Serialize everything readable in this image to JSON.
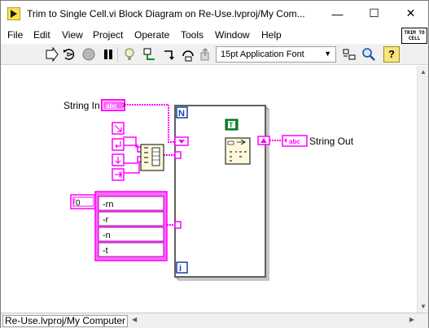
{
  "window": {
    "title": "Trim to Single Cell.vi Block Diagram on Re-Use.lvproj/My Com...",
    "minimize_glyph": "—",
    "maximize_glyph": "☐",
    "close_glyph": "✕"
  },
  "menu": {
    "items": [
      "File",
      "Edit",
      "View",
      "Project",
      "Operate",
      "Tools",
      "Window",
      "Help"
    ]
  },
  "vi_icon": {
    "line1": "TRIM TO",
    "line2": "CELL"
  },
  "toolbar": {
    "icons": [
      "run-arrow-icon",
      "run-continuously-icon",
      "abort-icon",
      "pause-icon",
      "highlight-execution-icon",
      "retain-wire-values-icon",
      "step-into-icon",
      "step-over-icon",
      "step-out-icon"
    ],
    "font_select": "15pt Application Font",
    "help_label": "?"
  },
  "diagram": {
    "string_in_label": "String In",
    "string_out_label": "String Out",
    "terminal_type": "abc",
    "loop_count_label": "N",
    "loop_iteration_label": "i",
    "case_true_label": "T",
    "array_index": "0",
    "array_items": [
      "-rn",
      "-r",
      "-n",
      "-t"
    ]
  },
  "status": {
    "path": "Re-Use.lvproj/My Computer"
  }
}
